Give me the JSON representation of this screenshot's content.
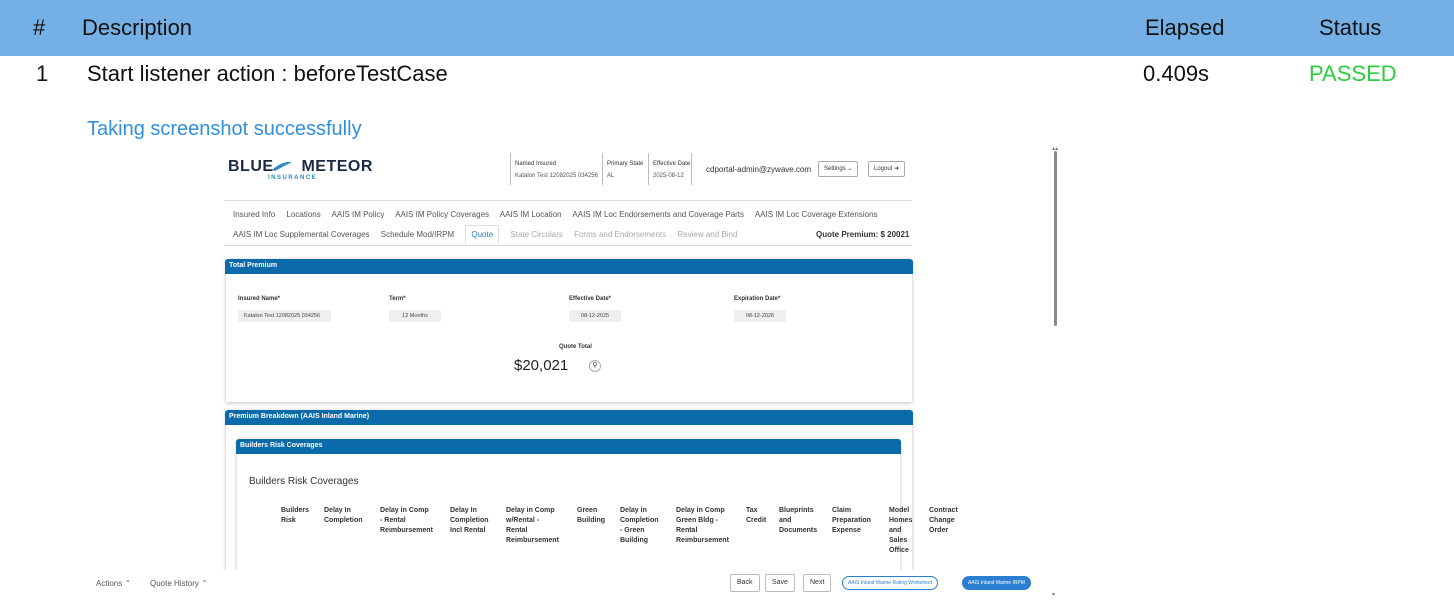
{
  "report": {
    "headers": {
      "num": "#",
      "description": "Description",
      "elapsed": "Elapsed",
      "status": "Status"
    },
    "row": {
      "num": "1",
      "description": "Start listener action : beforeTestCase",
      "elapsed": "0.409s",
      "status": "PASSED"
    },
    "screenshot_label": "Taking screenshot successfully",
    "colors": {
      "header_bg": "#74b0e6",
      "passed": "#2ecc40",
      "link": "#2f8fe0"
    }
  },
  "app": {
    "logo": {
      "main": "BLUE",
      "main2": "METEOR",
      "sub": "INSURANCE"
    },
    "header": {
      "named_insured_label": "Named Insured",
      "named_insured_value": "Katalon Test 12082025 034256",
      "primary_state_label": "Primary State",
      "primary_state_value": "AL",
      "effective_date_label": "Effective Date",
      "effective_date_value": "2025-08-12",
      "email": "cdportal-admin@zywave.com",
      "settings_label": "Settings",
      "logout_label": "Logout"
    },
    "tabs_row1": [
      "Insured Info",
      "Locations",
      "AAIS IM Policy",
      "AAIS IM Policy Coverages",
      "AAIS IM Location",
      "AAIS IM Loc Endorsements and Coverage Parts",
      "AAIS IM Loc Coverage Extensions"
    ],
    "tabs_row2": {
      "normal": [
        "AAIS IM Loc Supplemental Coverages",
        "Schedule Mod/IRPM"
      ],
      "active": "Quote",
      "disabled": [
        "State Circulars",
        "Forms and Endorsements",
        "Review and Bind"
      ]
    },
    "quote_premium": "Quote Premium: $ 20021",
    "total_premium": {
      "title": "Total Premium",
      "insured_name_label": "Insured Name*",
      "insured_name_value": "Katalon Test 12082025 034256",
      "term_label": "Term*",
      "term_value": "12 Months",
      "effective_date_label": "Effective Date*",
      "effective_date_value": "08-12-2025",
      "expiration_date_label": "Expiration Date*",
      "expiration_date_value": "08-12-2026",
      "quote_total_label": "Quote Total",
      "quote_total_value": "$20,021"
    },
    "breakdown_title": "Premium Breakdown (AAIS Inland Marine)",
    "builders_risk_bar": "Builders Risk Coverages",
    "builders_risk_title": "Builders Risk Coverages",
    "columns": [
      [
        "Builders",
        "Risk"
      ],
      [
        "Delay In",
        "Completion"
      ],
      [
        "Delay in Comp",
        "- Rental",
        "Reimbursement"
      ],
      [
        "Delay In",
        "Completion",
        "Incl Rental"
      ],
      [
        "Delay in Comp",
        "w/Rental -",
        "Rental",
        "Reimbursement"
      ],
      [
        "Green",
        "Building"
      ],
      [
        "Delay in",
        "Completion",
        "- Green",
        "Building"
      ],
      [
        "Delay in Comp",
        "Green Bldg -",
        "Rental",
        "Reimbursement"
      ],
      [
        "Tax",
        "Credit"
      ],
      [
        "Blueprints",
        "and",
        "Documents"
      ],
      [
        "Claim",
        "Preparation",
        "Expense"
      ],
      [
        "Model",
        "Homes",
        "and",
        "Sales",
        "Office"
      ],
      [
        "Contract",
        "Change",
        "Order"
      ]
    ],
    "footer": {
      "actions": "Actions",
      "quote_history": "Quote History",
      "back": "Back",
      "save": "Save",
      "next": "Next",
      "worksheet": "AAIS Inland Marine Rating Worksheet",
      "irpm": "AAIS Inland Marine IRPM"
    }
  }
}
